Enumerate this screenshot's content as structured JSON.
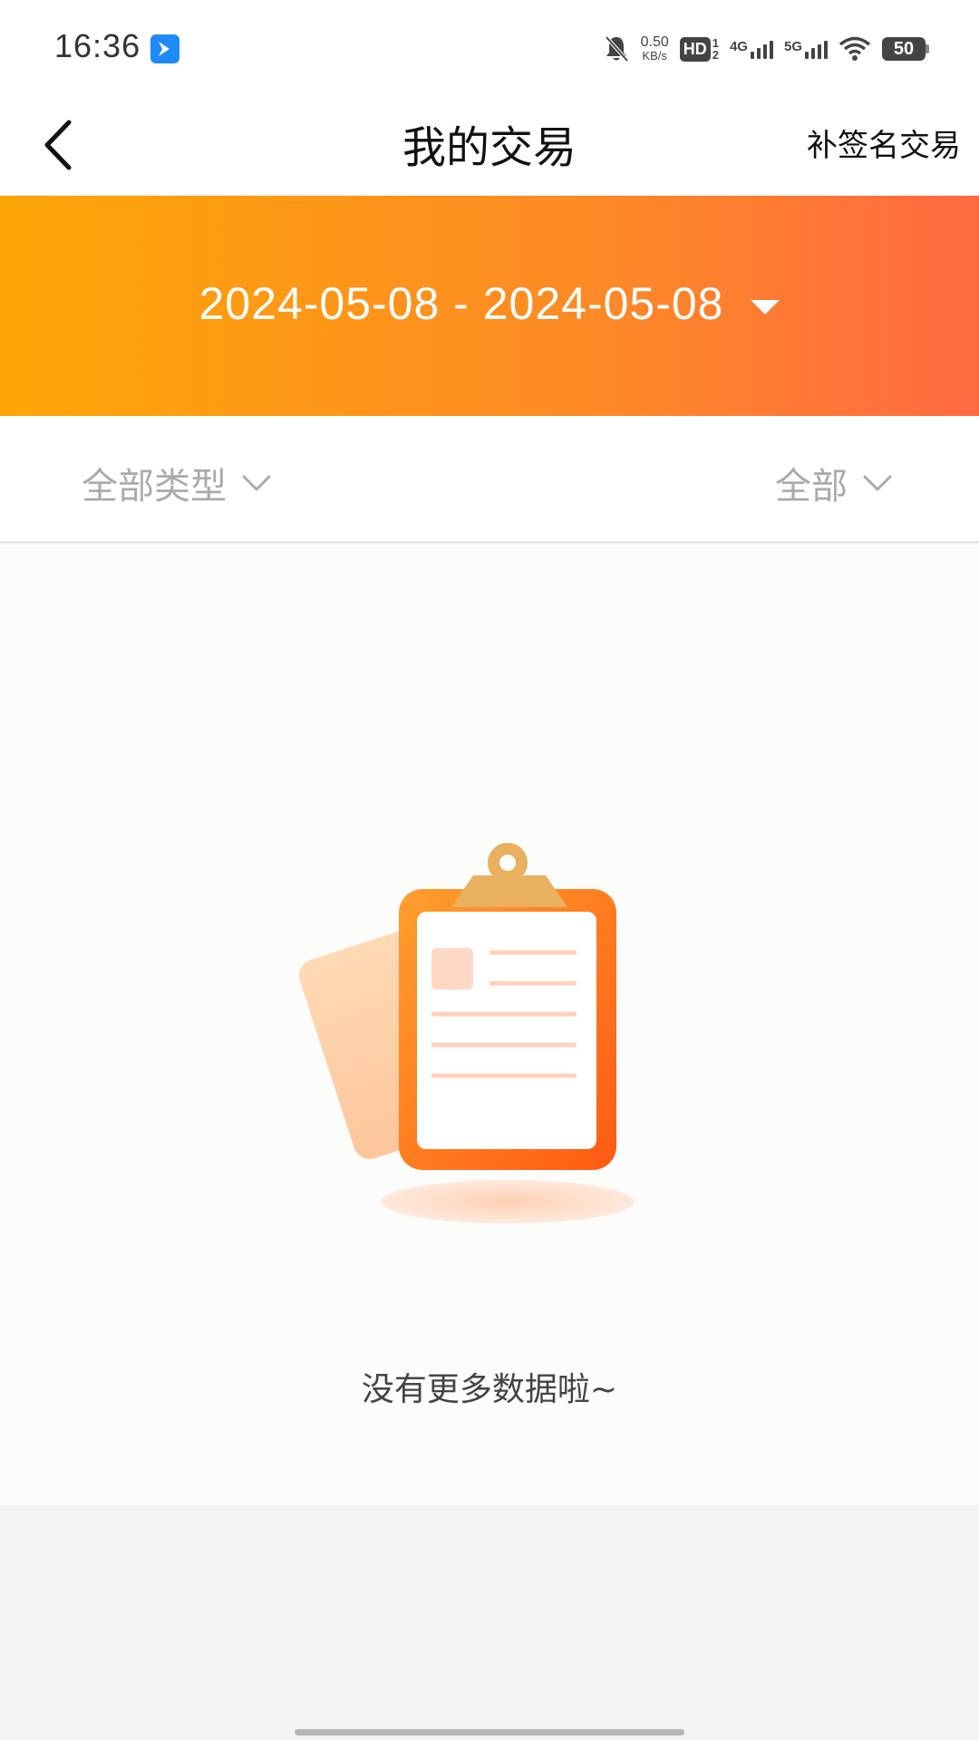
{
  "status_bar": {
    "time": "16:36",
    "net_speed_value": "0.50",
    "net_speed_unit": "KB/s",
    "hd_label": "HD",
    "hd_sub_top": "1",
    "hd_sub_bottom": "2",
    "net1_label": "4G",
    "net2_label": "5G",
    "battery": "50",
    "icons": [
      "app-icon",
      "mute-bell-icon",
      "signal-icon",
      "wifi-icon",
      "battery-icon"
    ]
  },
  "nav": {
    "title": "我的交易",
    "action_label": "补签名交易",
    "back_icon": "chevron-left-icon"
  },
  "banner": {
    "date_range": "2024-05-08 - 2024-05-08",
    "gradient_start": "#ffa607",
    "gradient_end": "#ff6a42"
  },
  "filters": {
    "type_label": "全部类型",
    "status_label": "全部"
  },
  "empty_state": {
    "icon": "clipboard-icon",
    "message": "没有更多数据啦~"
  }
}
